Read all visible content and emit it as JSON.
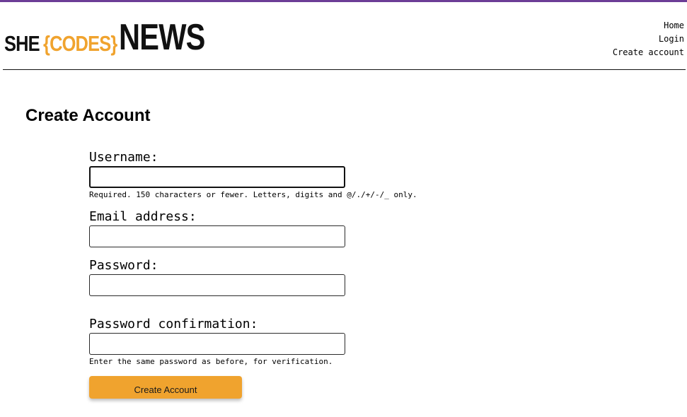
{
  "brand": {
    "part1": "SHE",
    "part2": "{CODES}",
    "part3": "NEWS"
  },
  "nav": {
    "items": [
      "Home",
      "Login",
      "Create account"
    ]
  },
  "page": {
    "title": "Create Account"
  },
  "form": {
    "username": {
      "label": "Username:",
      "value": "",
      "help": "Required. 150 characters or fewer. Letters, digits and @/./+/-/_ only."
    },
    "email": {
      "label": "Email address:",
      "value": ""
    },
    "password": {
      "label": "Password:",
      "value": ""
    },
    "password_confirmation": {
      "label": "Password confirmation:",
      "value": "",
      "help": "Enter the same password as before, for verification."
    },
    "submit_label": "Create Account"
  },
  "colors": {
    "accent": "#f0a32e",
    "top_strip": "#6c3d96",
    "text": "#000000"
  }
}
